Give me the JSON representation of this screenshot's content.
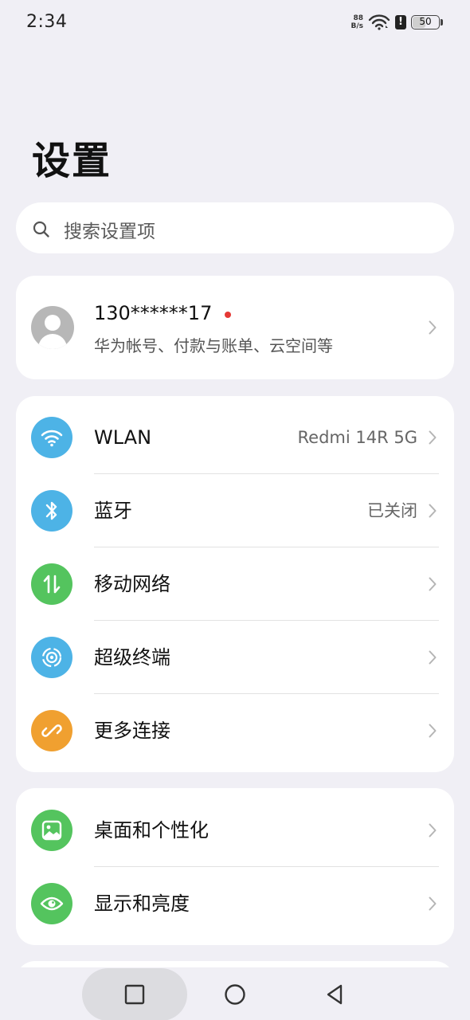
{
  "status_bar": {
    "time": "2:34",
    "net_speed_value": "88",
    "net_speed_unit": "B/s",
    "alert": "!",
    "battery": "50"
  },
  "title": "设置",
  "search": {
    "placeholder": "搜索设置项"
  },
  "account": {
    "name": "130******17",
    "subtitle": "华为帐号、付款与账单、云空间等"
  },
  "connectivity": {
    "items": [
      {
        "label": "WLAN",
        "value": "Redmi 14R 5G",
        "icon": "wifi-icon",
        "color": "#4db3e6"
      },
      {
        "label": "蓝牙",
        "value": "已关闭",
        "icon": "bluetooth-icon",
        "color": "#4db3e6"
      },
      {
        "label": "移动网络",
        "value": "",
        "icon": "mobile-data-icon",
        "color": "#54c45e"
      },
      {
        "label": "超级终端",
        "value": "",
        "icon": "super-device-icon",
        "color": "#4db3e6"
      },
      {
        "label": "更多连接",
        "value": "",
        "icon": "link-icon",
        "color": "#f0a030"
      }
    ]
  },
  "display": {
    "items": [
      {
        "label": "桌面和个性化",
        "value": "",
        "icon": "wallpaper-icon",
        "color": "#54c45e"
      },
      {
        "label": "显示和亮度",
        "value": "",
        "icon": "eye-icon",
        "color": "#54c45e"
      }
    ]
  },
  "colors": {
    "background": "#f0eff5",
    "card": "#ffffff",
    "notification_dot": "#e53935"
  }
}
